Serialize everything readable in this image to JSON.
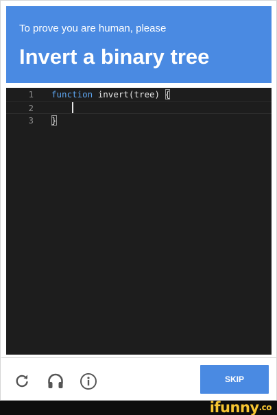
{
  "header": {
    "prompt": "To prove you are human, please",
    "task": "Invert a binary tree"
  },
  "editor": {
    "lines": [
      {
        "number": "1",
        "keyword": "function",
        "rest": " invert(tree) ",
        "bracket": "{"
      },
      {
        "number": "2",
        "text": ""
      },
      {
        "number": "3",
        "bracket": "}"
      }
    ]
  },
  "footer": {
    "skip_label": "SKIP",
    "icons": [
      "refresh-icon",
      "headphones-icon",
      "info-icon"
    ]
  },
  "watermark": {
    "text": "ifunny",
    "tld": ".co"
  },
  "colors": {
    "accent": "#4a8ae2",
    "editor_bg": "#1d1d1d",
    "keyword": "#5ea7f3",
    "watermark": "#f6c531"
  }
}
